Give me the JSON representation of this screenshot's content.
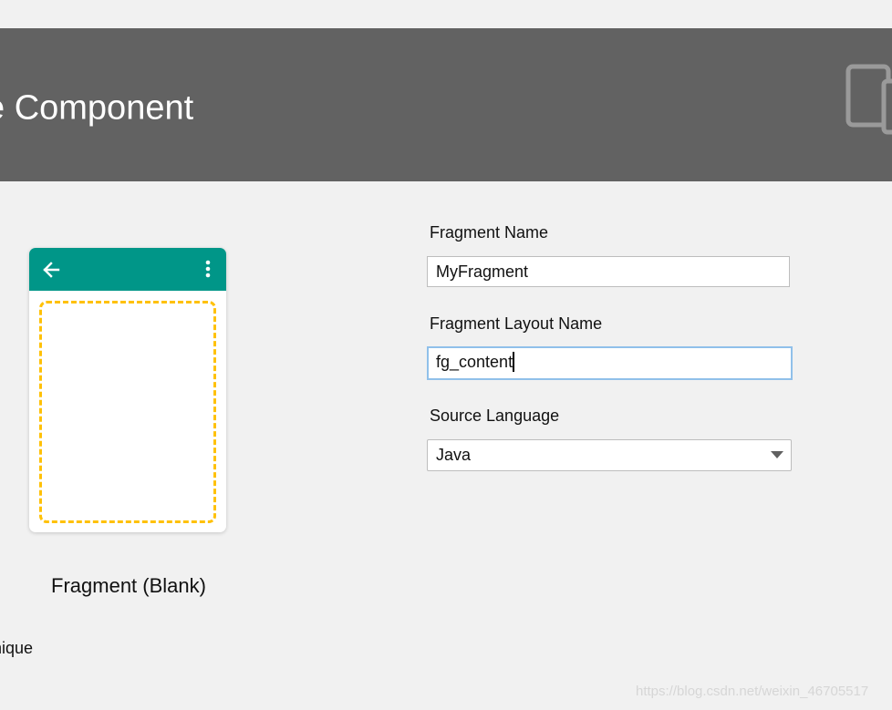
{
  "header": {
    "title": "e Component",
    "icon": "devices-icon"
  },
  "preview": {
    "back_icon": "back-arrow-icon",
    "menu_icon": "more-vert-icon",
    "template_name": "Fragment (Blank)",
    "colors": {
      "appbar": "#009688",
      "dashed_border": "#ffc107"
    }
  },
  "hint": {
    "text": "nique"
  },
  "form": {
    "fragment_name": {
      "label": "Fragment Name",
      "value": "MyFragment"
    },
    "layout_name": {
      "label": "Fragment Layout Name",
      "value": "fg_content"
    },
    "source_language": {
      "label": "Source Language",
      "value": "Java"
    }
  },
  "watermark": "https://blog.csdn.net/weixin_46705517"
}
